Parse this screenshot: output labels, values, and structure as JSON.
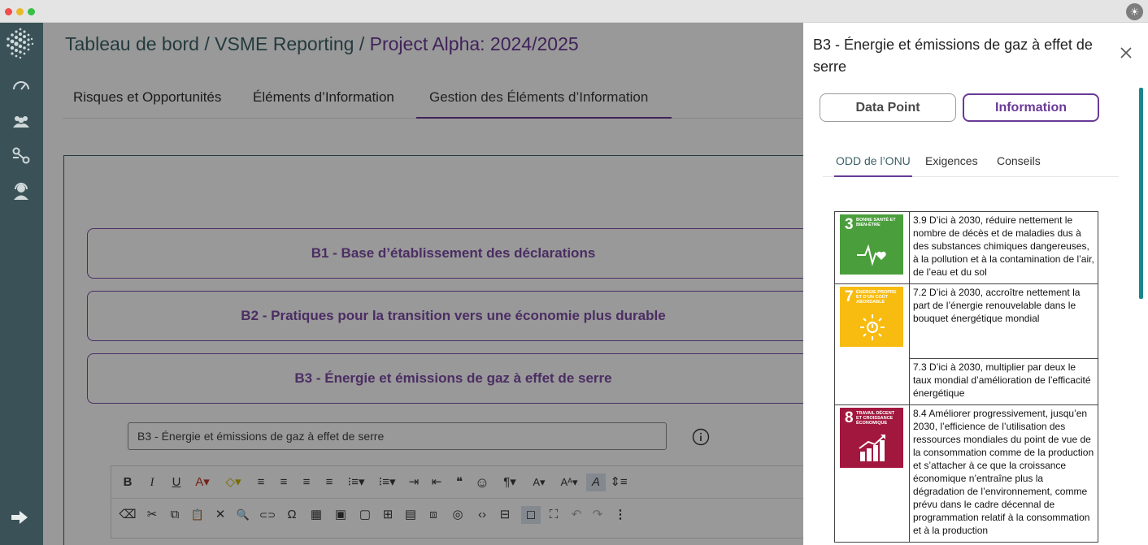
{
  "colors": {
    "accent": "#6a3a96",
    "teal": "#3c6168",
    "sidebar": "#3a5257",
    "sdg3": "#4a9f3c",
    "sdg7": "#f8bb0f",
    "sdg8": "#a2173e"
  },
  "breadcrumb": {
    "home": "Tableau de bord",
    "sep1": " / ",
    "module": "VSME Reporting",
    "sep2": " / ",
    "current": "Project Alpha: 2024/2025"
  },
  "tabs": [
    "Risques et Opportunités",
    "Éléments d’Information",
    "Gestion des Éléments d’Information"
  ],
  "sections": [
    "B1 - Base d’établissement des déclarations",
    "B2 - Pratiques pour la transition vers une économie plus durable",
    "B3 - Énergie et émissions de gaz à effet de serre"
  ],
  "field": {
    "value": "B3 - Énergie et émissions de gaz à effet de serre"
  },
  "toolbar": {
    "bold": "B",
    "italic": "I",
    "underline": "U",
    "font_color": "A▾",
    "highlight": "◇▾",
    "align_left": "≡",
    "align_center": "≡",
    "align_right": "≡",
    "justify": "≡",
    "ordered_list": "⁝≡▾",
    "bullet_list": "⁝≡▾",
    "indent": "⇥",
    "outdent": "⇤",
    "quote": "❝",
    "emoji": "☺",
    "paragraph": "¶▾",
    "font_size": "A▾",
    "case": "Aᴬ▾",
    "clear_format": "A",
    "line_height": "⇕≡",
    "eraser": "⌫",
    "cut": "✂",
    "copy": "⧉",
    "paste": "📋",
    "remove_format": "✕",
    "find": "🔍",
    "link": "⊂⊃",
    "special_char": "Ω",
    "table": "▦",
    "image": "▣",
    "video": "▢",
    "file": "⊞",
    "template": "▤",
    "embed": "⧈",
    "preview": "◎",
    "code": "‹›",
    "select_all": "⊟",
    "show_blocks": "◻",
    "fullscreen": "⛶",
    "undo": "↶",
    "redo": "↷",
    "more": "⋮"
  },
  "drawer": {
    "title": "B3 - Énergie et émissions de gaz à effet de serre",
    "buttons": {
      "data_point": "Data Point",
      "information": "Information"
    },
    "subtabs": [
      "ODD de l’ONU",
      "Exigences",
      "Conseils"
    ],
    "sdg": {
      "goal3": {
        "number": "3",
        "label": "BONNE SANTÉ ET BIEN-ÊTRE"
      },
      "goal7": {
        "number": "7",
        "label": "ÉNERGIE PROPRE ET D’UN COÛT ABORDABLE"
      },
      "goal8": {
        "number": "8",
        "label": "TRAVAIL DÉCENT ET CROISSANCE ÉCONOMIQUE"
      }
    },
    "targets": {
      "t39": "3.9 D’ici à 2030, réduire nettement le nombre de décès et de maladies dus à des substances chimiques dangereuses, à la pollution et à la contamination de l’air, de l’eau et du sol",
      "t72": "7.2 D’ici à 2030, accroître nettement la part de l’énergie renouvelable dans le bouquet énergétique mondial",
      "t73": "7.3 D’ici à 2030, multiplier par deux le taux mondial d’amélioration de l’efficacité énergétique",
      "t84": "8.4 Améliorer progressivement, jusqu’en 2030, l’efficience de l’utilisation des ressources mondiales du point de vue de la consommation comme de la production et s’attacher à ce que la croissance économique n’entraîne plus la dégradation de l’environnement, comme prévu dans le cadre décennal de programmation relatif à la consommation et à la production"
    }
  }
}
